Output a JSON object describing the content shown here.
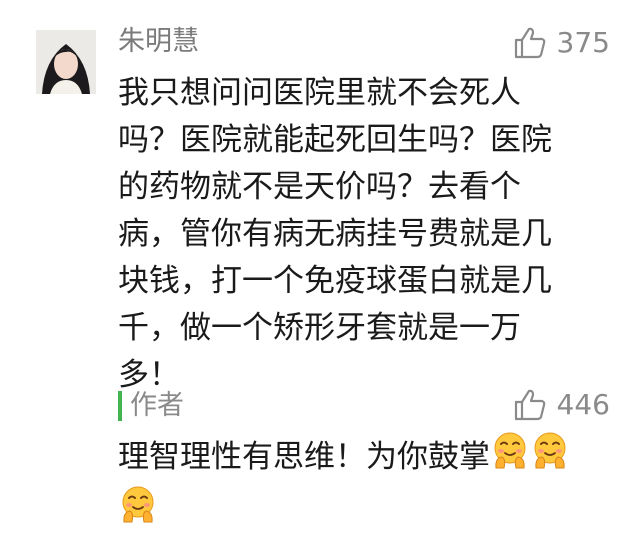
{
  "comment": {
    "username": "朱明慧",
    "likes": "375",
    "lines": [
      "我只想问问医院里就不会死人",
      "吗？医院就能起死回生吗？医院",
      "的药物就不是天价吗？去看个",
      "病，管你有病无病挂号费就是几",
      "块钱，打一个免疫球蛋白就是几",
      "千，做一个矫形牙套就是一万",
      "多！"
    ]
  },
  "reply": {
    "author_label": "作者",
    "likes": "446",
    "line1_text": "理智理性有思维！为你鼓掌",
    "emoji_name": "applause-emoji",
    "emoji_count": 3
  },
  "colors": {
    "author_bar": "#41b64f",
    "meta_text": "#8a8a8a",
    "body_text": "#1a1a1a"
  }
}
